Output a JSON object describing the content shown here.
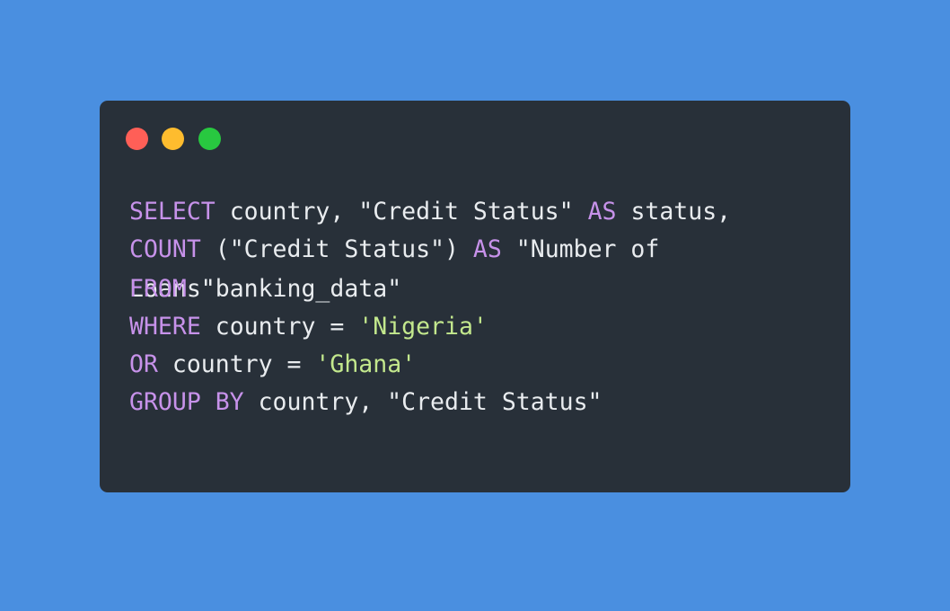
{
  "colors": {
    "background": "#4a8fe0",
    "window": "#283039",
    "keyword": "#c792ea",
    "string": "#c3e88d",
    "text": "#e9ecef",
    "dot_close": "#ff5f57",
    "dot_minimize": "#febc2e",
    "dot_maximize": "#28c840"
  },
  "code": {
    "line1": {
      "kw1": "SELECT",
      "t1": " country, \"Credit Status\" ",
      "kw2": "AS",
      "t2": " status,"
    },
    "line2": {
      "kw1": "COUNT",
      "t1": " (\"Credit Status\") ",
      "kw2": "AS",
      "t2": " \"Number of"
    },
    "line3a": {
      "t1": "Loans\""
    },
    "line3b": {
      "kw1": "FROM",
      "t1": " \"banking_data\""
    },
    "line4": {
      "kw1": "WHERE",
      "t1": " country = ",
      "s1": "'Nigeria'"
    },
    "line5": {
      "kw1": "OR",
      "t1": " country = ",
      "s1": "'Ghana'"
    },
    "line6": {
      "kw1": "GROUP BY",
      "t1": " country, \"Credit Status\""
    }
  }
}
